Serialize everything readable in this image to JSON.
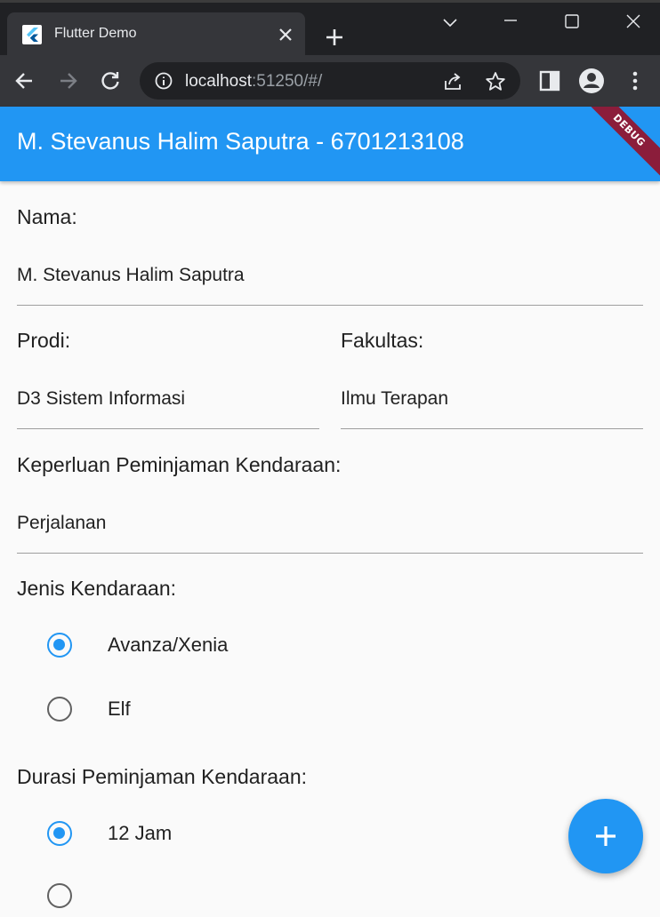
{
  "browser": {
    "tab_title": "Flutter Demo",
    "url_host": "localhost",
    "url_rest": ":51250/#/"
  },
  "appbar": {
    "title": "M. Stevanus Halim Saputra - 6701213108",
    "debug_banner": "DEBUG",
    "color": "#2196f3"
  },
  "form": {
    "nama_label": "Nama:",
    "nama_value": "M. Stevanus Halim Saputra",
    "prodi_label": "Prodi:",
    "prodi_value": "D3 Sistem Informasi",
    "fakultas_label": "Fakultas:",
    "fakultas_value": "Ilmu Terapan",
    "keperluan_label": "Keperluan Peminjaman Kendaraan:",
    "keperluan_value": "Perjalanan",
    "jenis_label": "Jenis Kendaraan:",
    "jenis_options": [
      {
        "label": "Avanza/Xenia",
        "selected": true
      },
      {
        "label": "Elf",
        "selected": false
      }
    ],
    "durasi_label": "Durasi Peminjaman Kendaraan:",
    "durasi_options": [
      {
        "label": "12 Jam",
        "selected": true
      },
      {
        "label": "",
        "selected": false
      }
    ]
  },
  "fab": {
    "icon": "add-icon"
  }
}
